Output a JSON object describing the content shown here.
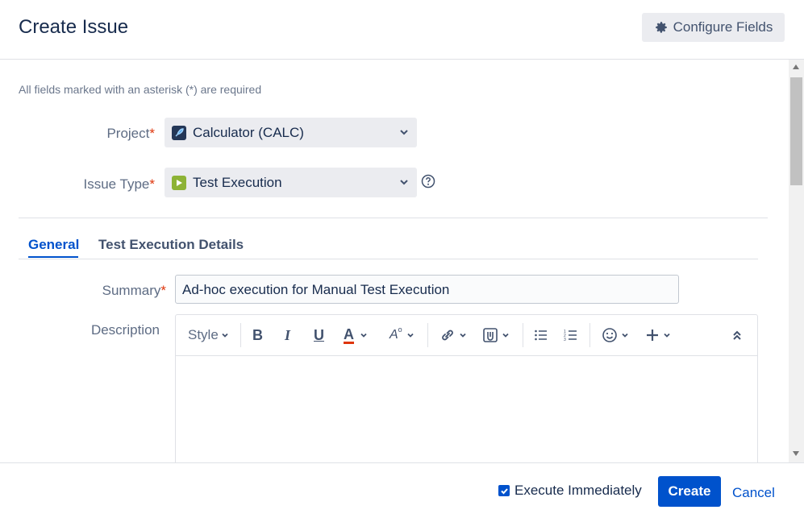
{
  "header": {
    "title": "Create Issue",
    "configure_fields_label": "Configure Fields"
  },
  "form": {
    "required_note": "All fields marked with an asterisk (*) are required",
    "project": {
      "label": "Project",
      "value": "Calculator (CALC)",
      "icon": "rocket-icon"
    },
    "issue_type": {
      "label": "Issue Type",
      "value": "Test Execution",
      "icon": "play-icon",
      "icon_color": "#8db336"
    },
    "tabs": [
      {
        "label": "General",
        "active": true
      },
      {
        "label": "Test Execution Details",
        "active": false
      }
    ],
    "summary": {
      "label": "Summary",
      "value": "Ad-hoc execution for Manual Test Execution"
    },
    "description": {
      "label": "Description"
    },
    "toolbar": {
      "style_label": "Style",
      "icons": [
        "bold-icon",
        "italic-icon",
        "underline-icon",
        "text-color-icon",
        "text-format-icon",
        "link-icon",
        "attachment-icon",
        "bullet-list-icon",
        "numbered-list-icon",
        "emoji-icon",
        "insert-plus-icon",
        "collapse-icon"
      ]
    }
  },
  "footer": {
    "execute_immediately_label": "Execute Immediately",
    "execute_immediately_checked": true,
    "create_label": "Create",
    "cancel_label": "Cancel"
  },
  "colors": {
    "primary": "#0052cc",
    "required": "#de350b",
    "text": "#172b4d"
  }
}
